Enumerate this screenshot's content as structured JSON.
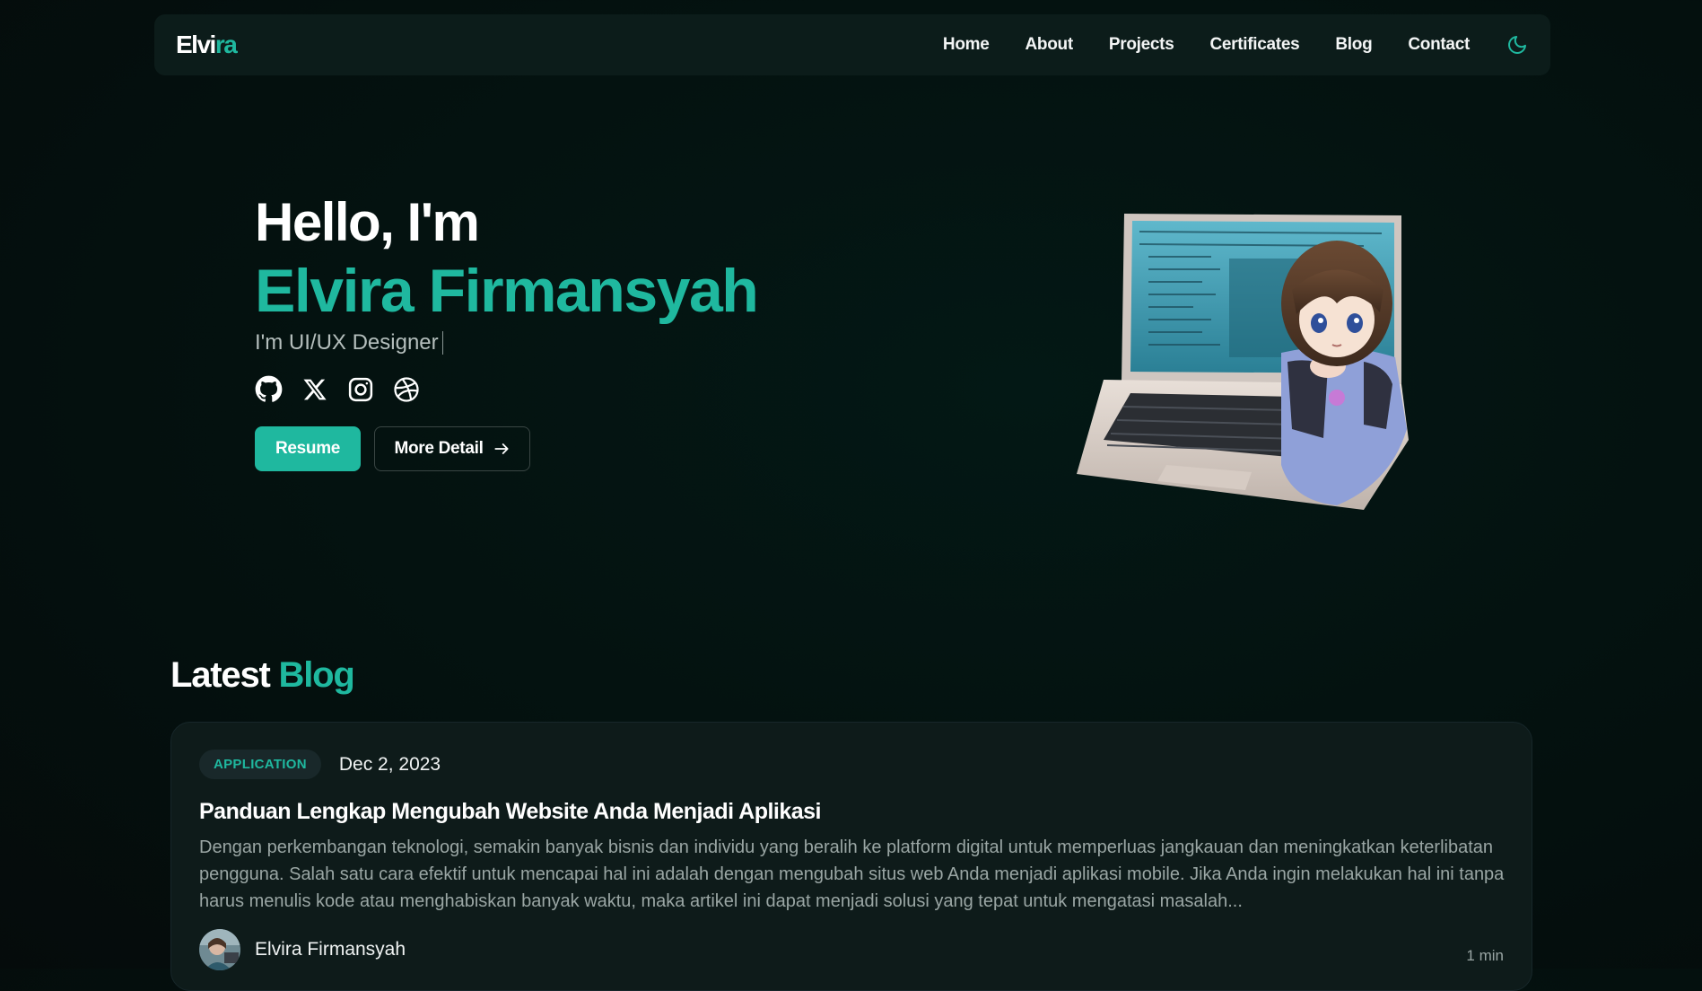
{
  "brand": {
    "logo_main": "Elvi",
    "logo_accent": "ra",
    "accent_color": "#1fb89f"
  },
  "nav": {
    "items": [
      {
        "label": "Home"
      },
      {
        "label": "About"
      },
      {
        "label": "Projects"
      },
      {
        "label": "Certificates"
      },
      {
        "label": "Blog"
      },
      {
        "label": "Contact"
      }
    ],
    "theme_toggle_icon": "moon-icon"
  },
  "hero": {
    "greeting": "Hello, I'm",
    "name": "Elvira Firmansyah",
    "role": "I'm UI/UX Designer",
    "socials": [
      {
        "icon": "github-icon"
      },
      {
        "icon": "x-twitter-icon"
      },
      {
        "icon": "instagram-icon"
      },
      {
        "icon": "dribbble-icon"
      }
    ],
    "primary_button": "Resume",
    "secondary_button": "More Detail",
    "illustration": "laptop-character-illustration"
  },
  "latest_blog": {
    "title_main": "Latest",
    "title_accent": "Blog",
    "posts": [
      {
        "category": "APPLICATION",
        "date": "Dec 2, 2023",
        "title": "Panduan Lengkap Mengubah Website Anda Menjadi Aplikasi",
        "excerpt": "Dengan perkembangan teknologi, semakin banyak bisnis dan individu yang beralih ke platform digital untuk memperluas jangkauan dan meningkatkan keterlibatan pengguna. Salah satu cara efektif untuk mencapai hal ini adalah dengan mengubah situs web Anda menjadi aplikasi mobile. Jika Anda ingin melakukan hal ini tanpa harus menulis kode atau menghabiskan banyak waktu, maka artikel ini dapat menjadi solusi yang tepat untuk mengatasi masalah...",
        "author": "Elvira Firmansyah",
        "read_time": "1 min"
      }
    ]
  }
}
